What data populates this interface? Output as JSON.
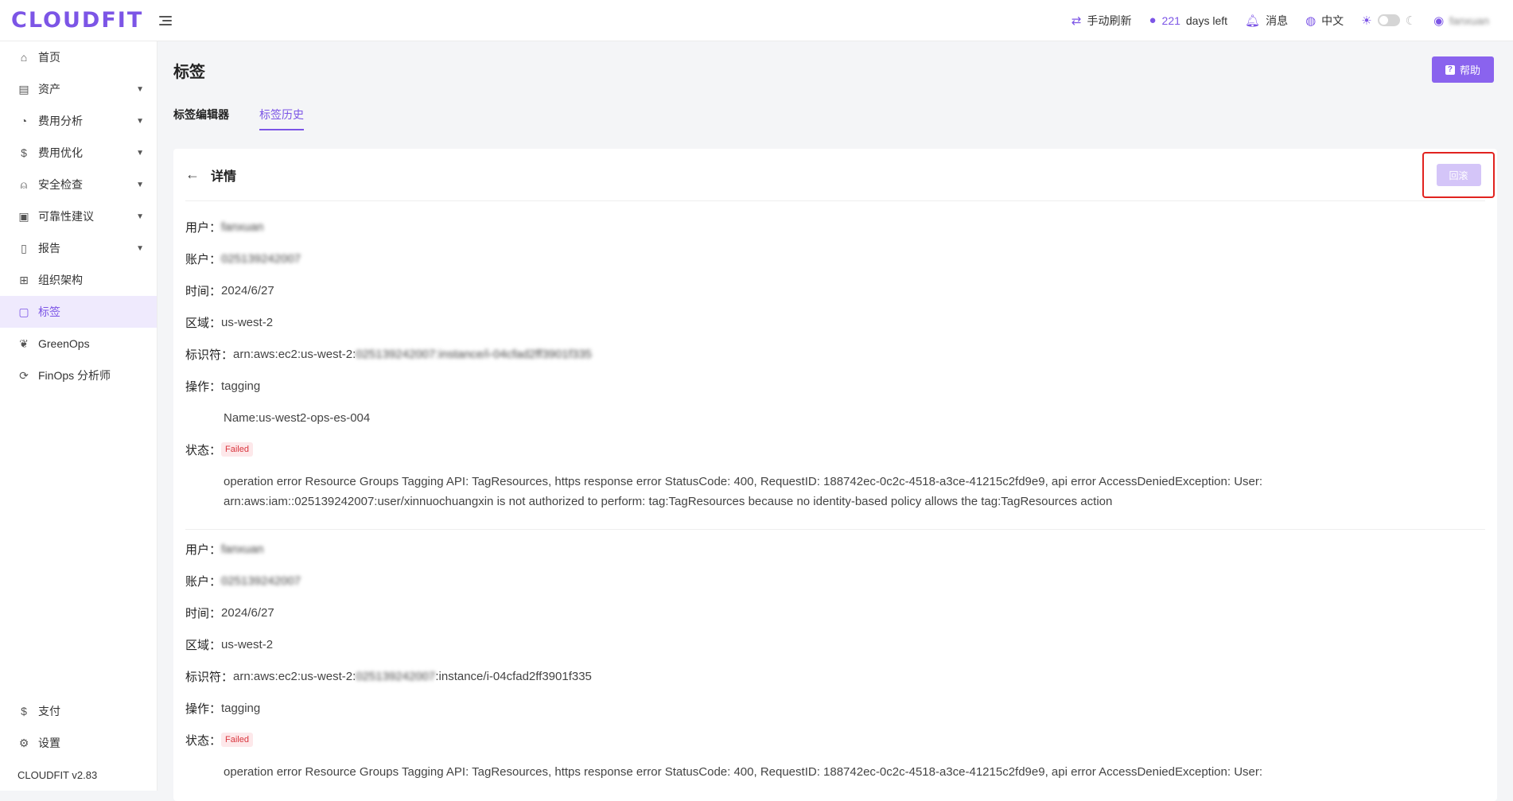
{
  "header": {
    "logo": "CLOUDFIT",
    "refresh_label": "手动刷新",
    "days_number": "221",
    "days_suffix": "days left",
    "messages_label": "消息",
    "language_label": "中文",
    "user_name": "fanxuan"
  },
  "sidebar": {
    "items": [
      {
        "label": "首页"
      },
      {
        "label": "资产"
      },
      {
        "label": "费用分析"
      },
      {
        "label": "费用优化"
      },
      {
        "label": "安全检查"
      },
      {
        "label": "可靠性建议"
      },
      {
        "label": "报告"
      },
      {
        "label": "组织架构"
      },
      {
        "label": "标签"
      },
      {
        "label": "GreenOps"
      },
      {
        "label": "FinOps 分析师"
      }
    ],
    "bottom": [
      {
        "label": "支付"
      },
      {
        "label": "设置"
      }
    ],
    "version": "CLOUDFIT v2.83"
  },
  "page": {
    "title": "标签",
    "help_label": "帮助",
    "tabs": [
      {
        "label": "标签编辑器"
      },
      {
        "label": "标签历史"
      }
    ]
  },
  "detail": {
    "title": "详情",
    "rollback_label": "回滚",
    "records": [
      {
        "user_label": "用户：",
        "user": "fanxuan",
        "account_label": "账户：",
        "account": "025139242007",
        "time_label": "时间：",
        "time": "2024/6/27",
        "region_label": "区域：",
        "region": "us-west-2",
        "arn_label": "标识符：",
        "arn_prefix": "arn:aws:ec2:us-west-2:",
        "arn_hidden": "025139242007:instance/i-04cfad2ff3901f335",
        "op_label": "操作：",
        "op": "tagging",
        "tag_value": "Name:us-west2-ops-es-004",
        "status_label": "状态：",
        "status": "Failed",
        "error_line1": "operation error Resource Groups Tagging API: TagResources, https response error StatusCode: 400, RequestID: 188742ec-0c2c-4518-a3ce-41215c2fd9e9, api error AccessDeniedException: User:",
        "error_line2": "arn:aws:iam::025139242007:user/xinnuochuangxin is not authorized to perform: tag:TagResources because no identity-based policy allows the tag:TagResources action"
      },
      {
        "user_label": "用户：",
        "user": "fanxuan",
        "account_label": "账户：",
        "account": "025139242007",
        "time_label": "时间：",
        "time": "2024/6/27",
        "region_label": "区域：",
        "region": "us-west-2",
        "arn_label": "标识符：",
        "arn_prefix": "arn:aws:ec2:us-west-2:",
        "arn_hidden": "025139242007",
        "arn_suffix": ":instance/i-04cfad2ff3901f335",
        "op_label": "操作：",
        "op": "tagging",
        "status_label": "状态：",
        "status": "Failed",
        "error_line1": "operation error Resource Groups Tagging API: TagResources, https response error StatusCode: 400, RequestID: 188742ec-0c2c-4518-a3ce-41215c2fd9e9, api error AccessDeniedException: User:"
      }
    ]
  },
  "colors": {
    "accent": "#7c55e6",
    "failed": "#d9363e",
    "highlight_border": "#e1231f"
  }
}
